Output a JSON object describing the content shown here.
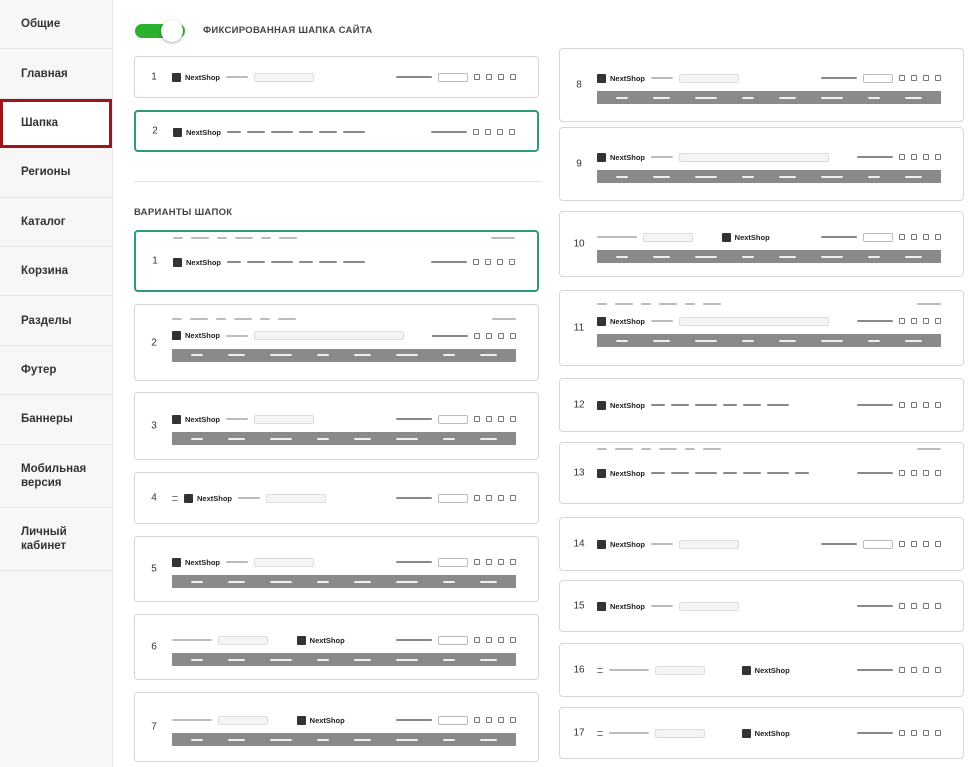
{
  "sidebar": {
    "items": [
      {
        "label": "Общие"
      },
      {
        "label": "Главная"
      },
      {
        "label": "Шапка",
        "active": true
      },
      {
        "label": "Регионы"
      },
      {
        "label": "Каталог"
      },
      {
        "label": "Корзина"
      },
      {
        "label": "Разделы"
      },
      {
        "label": "Футер"
      },
      {
        "label": "Баннеры"
      },
      {
        "label": "Мобильная версия"
      },
      {
        "label": "Личный кабинет"
      }
    ]
  },
  "fixed_header": {
    "label": "ФИКСИРОВАННАЯ ШАПКА САЙТА",
    "enabled": true,
    "accent": "#2cb12f"
  },
  "fixed_options": [
    {
      "number": "1",
      "selected": false
    },
    {
      "number": "2",
      "selected": true
    }
  ],
  "variants_title": "ВАРИАНТЫ ШАПОК",
  "variants_left": [
    {
      "number": "1",
      "selected": true
    },
    {
      "number": "2"
    },
    {
      "number": "3"
    },
    {
      "number": "4"
    },
    {
      "number": "5"
    },
    {
      "number": "6"
    },
    {
      "number": "7"
    }
  ],
  "variants_right": [
    {
      "number": "8"
    },
    {
      "number": "9"
    },
    {
      "number": "10"
    },
    {
      "number": "11"
    },
    {
      "number": "12"
    },
    {
      "number": "13"
    },
    {
      "number": "14"
    },
    {
      "number": "15"
    },
    {
      "number": "16"
    },
    {
      "number": "17"
    }
  ],
  "logo_text": "NextShop",
  "colors": {
    "selected_border": "#2e9a78",
    "active_item_border": "#a0151c",
    "nav_bar": "#8a8a8a"
  }
}
